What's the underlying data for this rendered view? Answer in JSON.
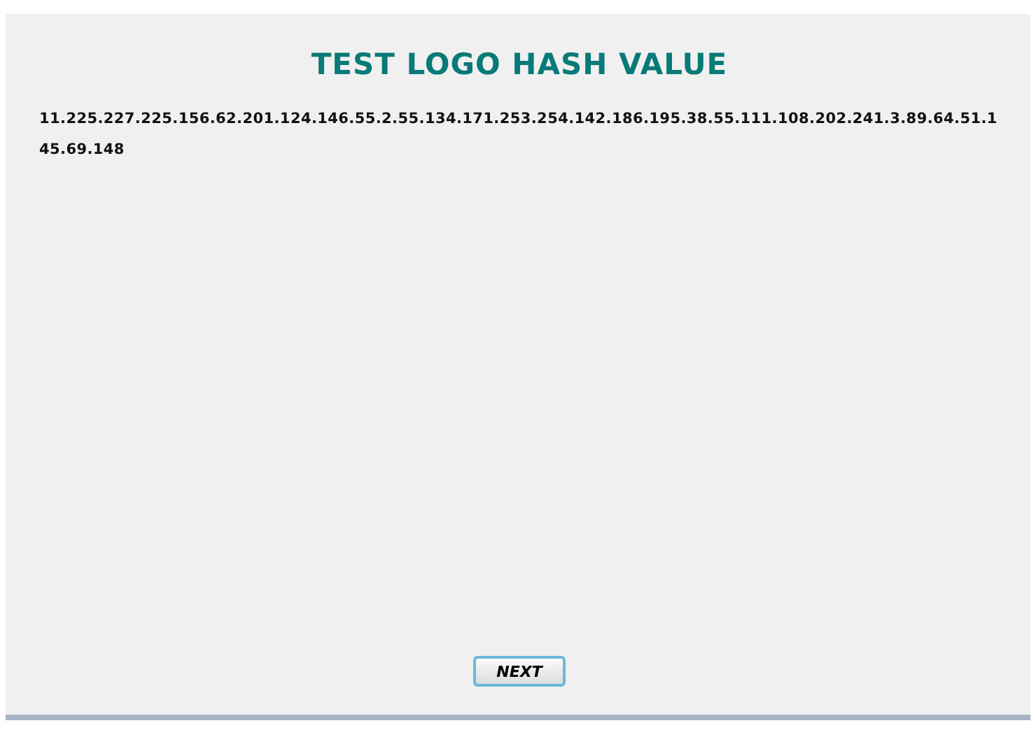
{
  "title": "TEST LOGO HASH VALUE",
  "hash_value": "11.225.227.225.156.62.201.124.146.55.2.55.134.171.253.254.142.186.195.38.55.111.108.202.241.3.89.64.51.145.69.148",
  "buttons": [
    {
      "label": "NEXT"
    }
  ]
}
